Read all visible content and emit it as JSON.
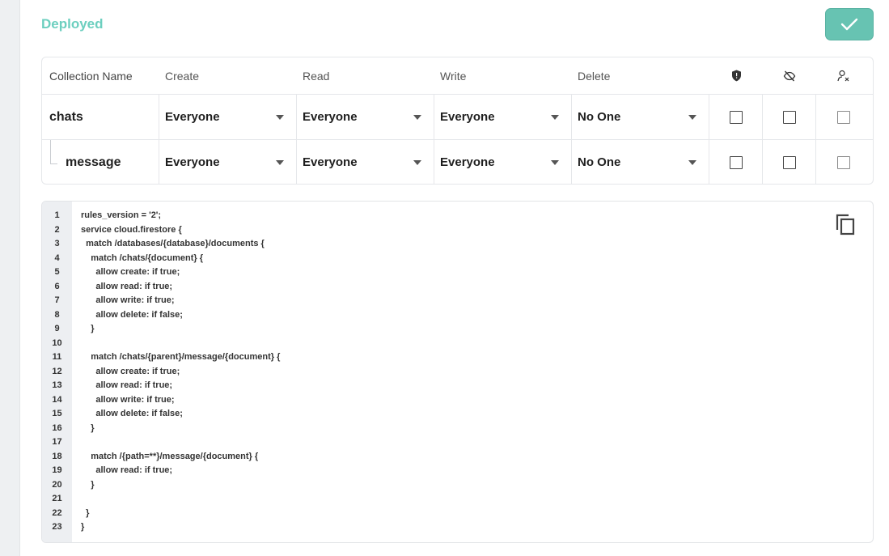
{
  "header": {
    "status": "Deployed",
    "confirm_icon": "check-icon"
  },
  "colors": {
    "accent": "#67c3b2",
    "status_text": "#6ccfbf"
  },
  "table": {
    "columns": [
      "Collection Name",
      "Create",
      "Read",
      "Write",
      "Delete"
    ],
    "icon_columns": [
      "shield-icon",
      "eye-off-icon",
      "user-remove-icon"
    ],
    "rows": [
      {
        "name": "chats",
        "create": "Everyone",
        "read": "Everyone",
        "write": "Everyone",
        "delete": "No One"
      },
      {
        "name": "message",
        "create": "Everyone",
        "read": "Everyone",
        "write": "Everyone",
        "delete": "No One"
      }
    ]
  },
  "code": {
    "copy_icon": "copy-icon",
    "lines": [
      "rules_version = '2';",
      "service cloud.firestore {",
      "  match /databases/{database}/documents {",
      "    match /chats/{document} {",
      "      allow create: if true;",
      "      allow read: if true;",
      "      allow write: if true;",
      "      allow delete: if false;",
      "    }",
      "",
      "    match /chats/{parent}/message/{document} {",
      "      allow create: if true;",
      "      allow read: if true;",
      "      allow write: if true;",
      "      allow delete: if false;",
      "    }",
      "",
      "    match /{path=**}/message/{document} {",
      "      allow read: if true;",
      "    }",
      "",
      "  }",
      "}"
    ]
  }
}
